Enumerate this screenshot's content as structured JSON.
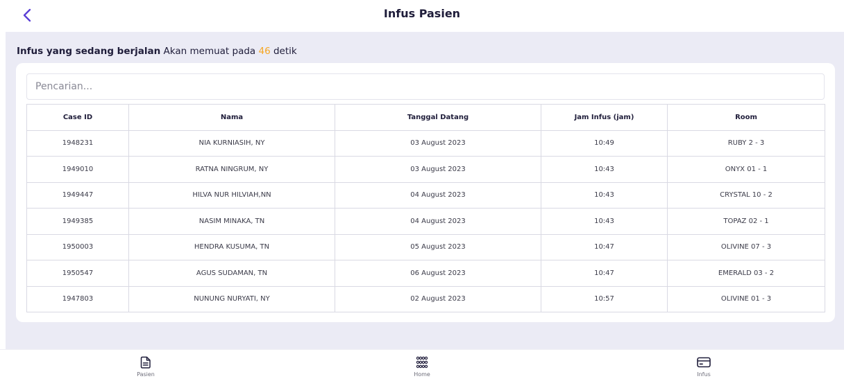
{
  "header": {
    "title": "Infus Pasien",
    "back_icon": "chevron-left-icon"
  },
  "status": {
    "prefix_bold": "Infus yang sedang berjalan",
    "middle": "Akan memuat pada",
    "countdown": "46",
    "suffix": "detik"
  },
  "search": {
    "placeholder": "Pencarian...",
    "value": ""
  },
  "table": {
    "headers": [
      "Case ID",
      "Nama",
      "Tanggal Datang",
      "Jam Infus (jam)",
      "Room"
    ],
    "rows": [
      [
        "1948231",
        "NIA KURNIASIH, NY",
        "03 August 2023",
        "10:49",
        "RUBY 2 - 3"
      ],
      [
        "1949010",
        "RATNA NINGRUM, NY",
        "03 August 2023",
        "10:43",
        "ONYX 01 - 1"
      ],
      [
        "1949447",
        "HILVA NUR HILVIAH,NN",
        "04 August 2023",
        "10:43",
        "CRYSTAL 10 - 2"
      ],
      [
        "1949385",
        "NASIM MINAKA, TN",
        "04 August 2023",
        "10:43",
        "TOPAZ 02 - 1"
      ],
      [
        "1950003",
        "HENDRA KUSUMA, TN",
        "05 August 2023",
        "10:47",
        "OLIVINE 07 - 3"
      ],
      [
        "1950547",
        "AGUS SUDAMAN, TN",
        "06 August 2023",
        "10:47",
        "EMERALD 03 - 2"
      ],
      [
        "1947803",
        "NUNUNG NURYATI, NY",
        "02 August 2023",
        "10:57",
        "OLIVINE 01 - 3"
      ]
    ]
  },
  "bottom_nav": {
    "items": [
      {
        "label": "Pasien",
        "icon": "document-icon"
      },
      {
        "label": "Home",
        "icon": "grid-dots-icon"
      },
      {
        "label": "Infus",
        "icon": "card-icon"
      }
    ]
  },
  "colors": {
    "accent": "#5b3fd6",
    "countdown": "#f5a623",
    "background": "#ebebf5"
  }
}
